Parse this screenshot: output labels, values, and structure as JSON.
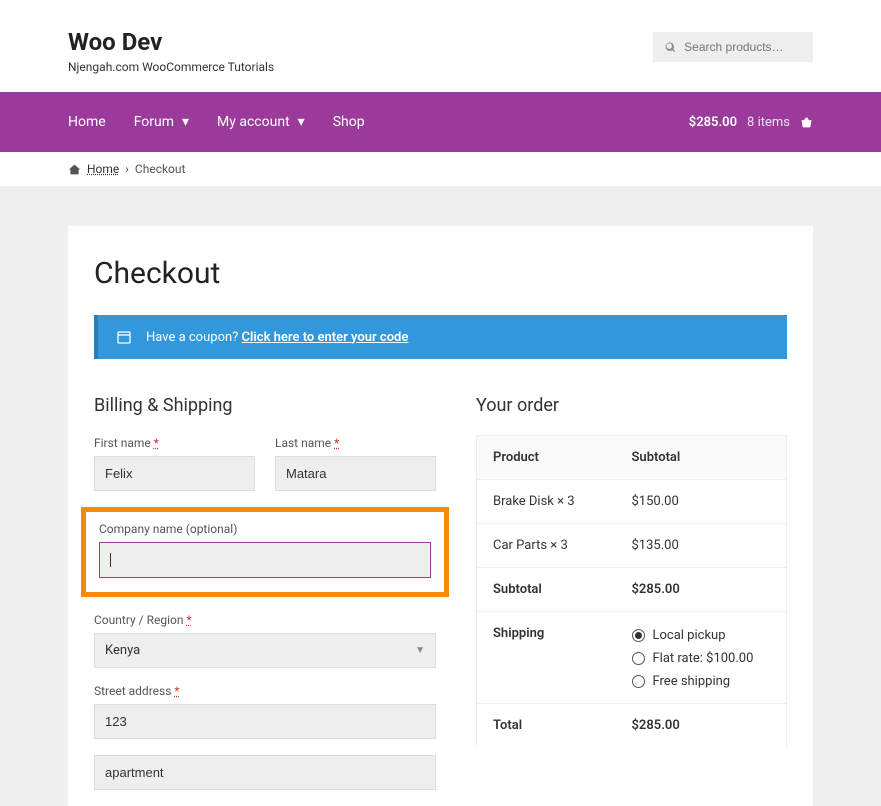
{
  "site": {
    "title": "Woo Dev",
    "tagline": "Njengah.com WooCommerce Tutorials"
  },
  "search": {
    "placeholder": "Search products…"
  },
  "nav": {
    "items": [
      "Home",
      "Forum",
      "My account",
      "Shop"
    ],
    "cart_total": "$285.00",
    "cart_items": "8 items"
  },
  "breadcrumb": {
    "home": "Home",
    "current": "Checkout",
    "sep": "›"
  },
  "page": {
    "title": "Checkout"
  },
  "coupon": {
    "prompt": "Have a coupon?",
    "link": "Click here to enter your code"
  },
  "billing": {
    "heading": "Billing & Shipping",
    "first_name_label": "First name",
    "first_name_value": "Felix",
    "last_name_label": "Last name",
    "last_name_value": "Matara",
    "company_label": "Company name (optional)",
    "company_value": "",
    "country_label": "Country / Region",
    "country_value": "Kenya",
    "street_label": "Street address",
    "street_value": "123",
    "apt_value": "apartment"
  },
  "order": {
    "heading": "Your order",
    "head_product": "Product",
    "head_subtotal": "Subtotal",
    "items": [
      {
        "name": "Brake Disk  × 3",
        "subtotal": "$150.00"
      },
      {
        "name": "Car Parts  × 3",
        "subtotal": "$135.00"
      }
    ],
    "subtotal_label": "Subtotal",
    "subtotal_value": "$285.00",
    "shipping_label": "Shipping",
    "shipping_options": [
      {
        "label": "Local pickup",
        "checked": true
      },
      {
        "label": "Flat rate: $100.00",
        "checked": false
      },
      {
        "label": "Free shipping",
        "checked": false
      }
    ],
    "total_label": "Total",
    "total_value": "$285.00"
  }
}
